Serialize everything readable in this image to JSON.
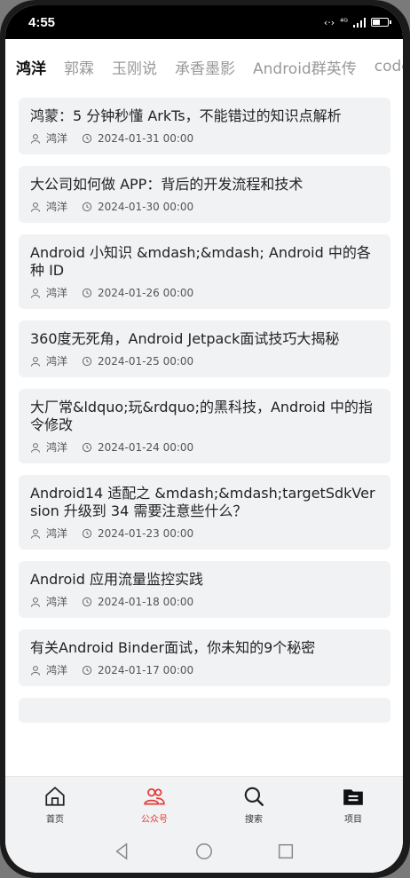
{
  "status_bar": {
    "time": "4:55",
    "network": "⁴ᴳ",
    "battery_level": 0.55
  },
  "tabs": [
    {
      "label": "鸿洋",
      "active": true
    },
    {
      "label": "郭霖",
      "active": false
    },
    {
      "label": "玉刚说",
      "active": false
    },
    {
      "label": "承香墨影",
      "active": false
    },
    {
      "label": "Android群英传",
      "active": false
    },
    {
      "label": "code",
      "active": false
    }
  ],
  "articles": [
    {
      "title": "鸿蒙：5 分钟秒懂 ArkTs，不能错过的知识点解析",
      "author": "鸿洋",
      "date": "2024-01-31 00:00"
    },
    {
      "title": "大公司如何做 APP：背后的开发流程和技术",
      "author": "鸿洋",
      "date": "2024-01-30 00:00"
    },
    {
      "title": "Android 小知识 &mdash;&mdash; Android 中的各种 ID",
      "author": "鸿洋",
      "date": "2024-01-26 00:00"
    },
    {
      "title": "360度无死角，Android Jetpack面试技巧大揭秘",
      "author": "鸿洋",
      "date": "2024-01-25 00:00"
    },
    {
      "title": "大厂常&ldquo;玩&rdquo;的黑科技，Android 中的指令修改",
      "author": "鸿洋",
      "date": "2024-01-24 00:00"
    },
    {
      "title": "Android14 适配之 &mdash;&mdash;targetSdkVersion 升级到 34 需要注意些什么？",
      "author": "鸿洋",
      "date": "2024-01-23 00:00"
    },
    {
      "title": "Android 应用流量监控实践",
      "author": "鸿洋",
      "date": "2024-01-18 00:00"
    },
    {
      "title": "有关Android Binder面试，你未知的9个秘密",
      "author": "鸿洋",
      "date": "2024-01-17 00:00"
    }
  ],
  "bottom_nav": [
    {
      "label": "首页",
      "icon": "home-icon",
      "active": false
    },
    {
      "label": "公众号",
      "icon": "people-icon",
      "active": true
    },
    {
      "label": "搜索",
      "icon": "search-icon",
      "active": false
    },
    {
      "label": "项目",
      "icon": "folder-icon",
      "active": false
    }
  ],
  "colors": {
    "accent": "#e53935",
    "card_bg": "#f1f2f4",
    "nav_bg": "#f1f2f4"
  }
}
